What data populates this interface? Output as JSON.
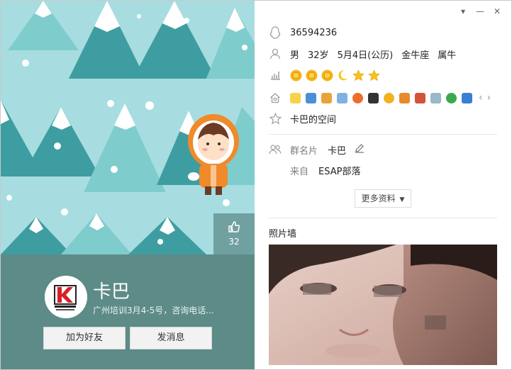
{
  "profile": {
    "nickname": "卡巴",
    "signature": "广州培训3月4-5号，咨询电话...",
    "likes": "32",
    "add_friend_label": "加为好友",
    "send_message_label": "发消息"
  },
  "window": {
    "menu_glyph": "▾",
    "minimize_glyph": "—",
    "close_glyph": "✕"
  },
  "details": {
    "qq_number": "36594236",
    "gender": "男",
    "age": "32岁",
    "birthday": "5月4日(公历)",
    "zodiac": "金牛座",
    "chinese_zodiac": "属牛",
    "level_badges": [
      "sun",
      "sun",
      "sun",
      "moon",
      "star",
      "star"
    ],
    "services": [
      "crown-star",
      "photo",
      "document",
      "mail",
      "g-app",
      "penguin",
      "coin",
      "pet",
      "game",
      "diamond",
      "earth",
      "music"
    ],
    "space_label": "卡巴的空间",
    "group_card_label": "群名片",
    "group_card_value": "卡巴",
    "from_label": "来自",
    "from_value": "ESAP部落",
    "more_label": "更多资料",
    "photo_wall_title": "照片墙"
  },
  "colors": {
    "profile_bg": "#5d8b87",
    "scene_bg": "#a7dde0",
    "tree_dark": "#3e9da1",
    "tree_light": "#7fcccc"
  }
}
